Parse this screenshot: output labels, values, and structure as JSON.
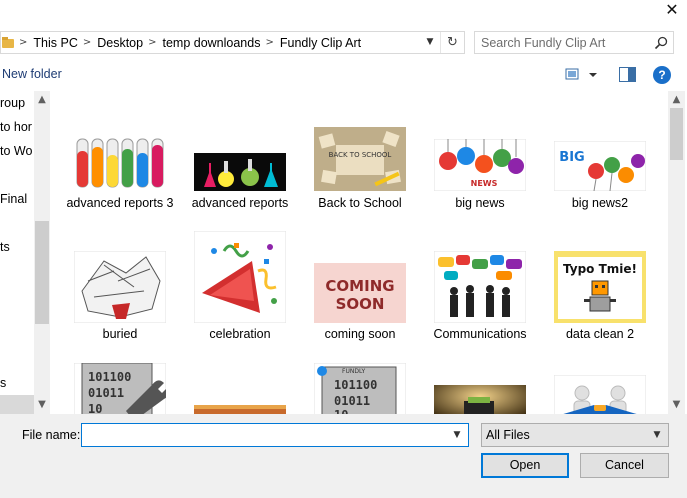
{
  "window": {
    "close_glyph": "✕"
  },
  "address": {
    "breadcrumbs": [
      "This PC",
      "Desktop",
      "temp downloands",
      "Fundly Clip Art"
    ],
    "separator": ">"
  },
  "search": {
    "placeholder": "Search Fundly Clip Art",
    "value": ""
  },
  "toolbar": {
    "new_folder": "New folder",
    "help_label": "?"
  },
  "nav_pane": {
    "items": [
      "roup",
      "to hor",
      "to Wo",
      "Final",
      "ts",
      "s"
    ]
  },
  "files": [
    {
      "label": "advanced reports 3",
      "icon": "test-tubes-image"
    },
    {
      "label": "advanced reports",
      "icon": "flasks-image"
    },
    {
      "label": "Back to School",
      "icon": "scrabble-tiles-image"
    },
    {
      "label": "big news",
      "icon": "news-balloons-image"
    },
    {
      "label": "big news2",
      "icon": "big-news-balloons-image"
    },
    {
      "label": "buried",
      "icon": "paper-pile-image"
    },
    {
      "label": "celebration",
      "icon": "party-horn-image"
    },
    {
      "label": "coming soon",
      "icon": "coming-soon-image"
    },
    {
      "label": "Communications",
      "icon": "speech-bubbles-image"
    },
    {
      "label": "data clean 2",
      "icon": "typo-robot-image"
    },
    {
      "label": "",
      "icon": "binary-wrench-image"
    },
    {
      "label": "",
      "icon": "partial-image"
    },
    {
      "label": "",
      "icon": "fundly-binary-image"
    },
    {
      "label": "",
      "icon": "dark-money-image"
    },
    {
      "label": "",
      "icon": "handshake-image"
    }
  ],
  "images_text": {
    "back_to_school": "BACK TO SCHOOL",
    "news_letters": "NEWS",
    "big": "BIG",
    "coming": "COMING",
    "soon": "SOON",
    "typo_tmie": "Typo Tmie!",
    "binary1": "101100",
    "binary2": "01011",
    "binary3": "10",
    "fundly": "FUNDLY"
  },
  "bottom": {
    "file_name_label": "File name:",
    "file_name_value": "",
    "filter": "All Files",
    "open": "Open",
    "cancel": "Cancel"
  }
}
